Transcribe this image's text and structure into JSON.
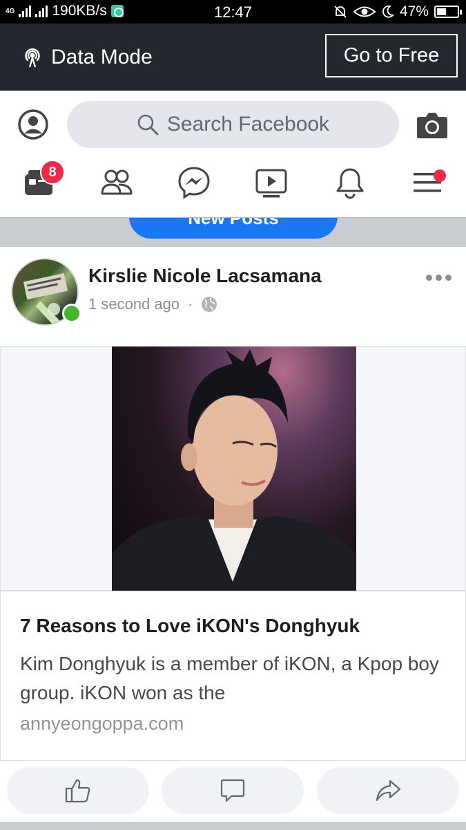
{
  "status_bar": {
    "network": "4G",
    "speed": "190KB/s",
    "time": "12:47",
    "battery": "47%",
    "battery_level": 0.47
  },
  "data_mode": {
    "label": "Data Mode",
    "go_free_label": "Go to Free"
  },
  "header": {
    "search_placeholder": "Search Facebook",
    "nav": [
      {
        "icon": "home-feed-icon"
      },
      {
        "icon": "friends-icon"
      },
      {
        "icon": "messenger-icon"
      },
      {
        "icon": "watch-icon"
      },
      {
        "icon": "notifications-icon"
      },
      {
        "icon": "menu-icon"
      }
    ],
    "home_badge": "8"
  },
  "feed": {
    "new_posts_label": "New Posts"
  },
  "post": {
    "author": "Kirslie Nicole Lacsamana",
    "time": "1 second ago",
    "separator": "·",
    "privacy_icon": "globe-icon",
    "link": {
      "title": "7 Reasons to Love iKON's Donghyuk",
      "description": "Kim Donghyuk is a member of iKON, a Kpop boy group. iKON won as the",
      "domain": "annyeongoppa.com"
    },
    "actions": [
      {
        "icon": "like-icon"
      },
      {
        "icon": "comment-icon"
      },
      {
        "icon": "share-icon"
      }
    ]
  },
  "colors": {
    "brand": "#1877f2",
    "badge": "#f02849",
    "online": "#42b72a",
    "data_bar": "#23272e"
  }
}
